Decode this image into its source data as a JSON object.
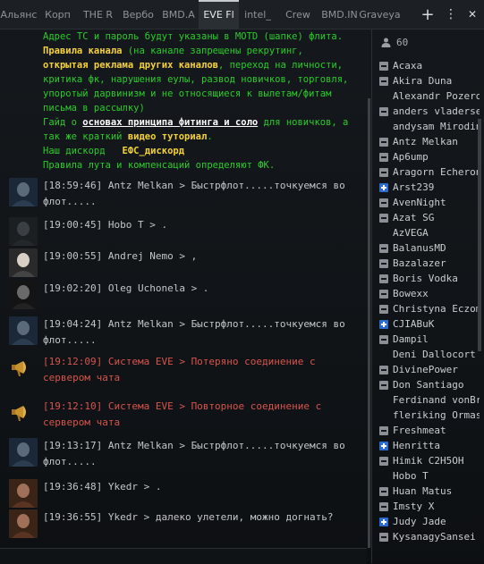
{
  "tabs": [
    {
      "label": "Альянс"
    },
    {
      "label": "Корп"
    },
    {
      "label": "THE R"
    },
    {
      "label": "Вербо"
    },
    {
      "label": "BMD.A"
    },
    {
      "label": "EVE Fl"
    },
    {
      "label": "intel_"
    },
    {
      "label": "Crew"
    },
    {
      "label": "BMD.IN"
    },
    {
      "label": "Graveya"
    }
  ],
  "tab_controls": {
    "add": "+",
    "menu": "⋮",
    "close": "✕"
  },
  "motd": {
    "line1": "Адрес ТС и пароль будут указаны в MOTD (шапке) флита.",
    "rules_label": "Правила канала",
    "rules_text1": " (на канале запрещены рекрутинг, ",
    "ads_label": "открытая реклама других каналов",
    "rules_text2": ", переход на личности, критика фк, нарушения еулы, развод новичков, торговля, упоротый дарвинизм и не относящиеся к вылетам/фитам письма в рассылку)",
    "guide_text1": "Гайд о ",
    "guide_link": "основах принципа фитинга и соло",
    "guide_text2": " для новичков, а так же краткий ",
    "video_label": "видео туториал",
    "guide_text3": ".",
    "discord_text": "Наш дискорд   ",
    "discord_link": "ЕФС_дискорд",
    "loot_text": "Правила лута и компенсаций определяют ФК."
  },
  "messages": [
    {
      "text": "[18:59:46] Antz Melkan > Быстрфлот.....точкуемся во флот.....",
      "type": "user",
      "avatar": "avatar-antz"
    },
    {
      "text": "[19:00:45] Hobo T > .",
      "type": "user",
      "avatar": "avatar-hobo"
    },
    {
      "text": "[19:00:55] Andrej Nemo > ,",
      "type": "user",
      "avatar": "avatar-andrej"
    },
    {
      "text": "[19:02:20] Oleg Uchonela > .",
      "type": "user",
      "avatar": "avatar-oleg"
    },
    {
      "text": "[19:04:24] Antz Melkan > Быстрфлот.....точкуемся во флот.....",
      "type": "user",
      "avatar": "avatar-antz"
    },
    {
      "text": "[19:12:09] Система EVE > Потеряно соединение с сервером чата",
      "type": "system",
      "avatar": "megaphone-icon"
    },
    {
      "text": "[19:12:10] Система EVE > Повторное соединение с сервером чата",
      "type": "system",
      "avatar": "megaphone-icon"
    },
    {
      "text": "[19:13:17] Antz Melkan > Быстрфлот.....точкуемся во флот.....",
      "type": "user",
      "avatar": "avatar-antz"
    },
    {
      "text": "[19:36:48] Ykedr > .",
      "type": "user",
      "avatar": "avatar-ykedr"
    },
    {
      "text": "[19:36:55] Ykedr > далеко улетели, можно догнать?",
      "type": "user",
      "avatar": "avatar-ykedr"
    }
  ],
  "member_count": "60",
  "members": [
    {
      "name": "Acaxa",
      "standing": "neutral"
    },
    {
      "name": "Akira Duna",
      "standing": "neutral"
    },
    {
      "name": "Alexandr Pozerov",
      "standing": "none"
    },
    {
      "name": "anders vladersen",
      "standing": "neutral"
    },
    {
      "name": "andysam Mirodin",
      "standing": "none"
    },
    {
      "name": "Antz Melkan",
      "standing": "neutral"
    },
    {
      "name": "Ap6ump",
      "standing": "neutral"
    },
    {
      "name": "Aragorn Echeron",
      "standing": "neutral"
    },
    {
      "name": "Arst239",
      "standing": "plus"
    },
    {
      "name": "AvenNight",
      "standing": "neutral"
    },
    {
      "name": "Azat SG",
      "standing": "neutral"
    },
    {
      "name": "AzVEGA",
      "standing": "none"
    },
    {
      "name": "BalanusMD",
      "standing": "neutral"
    },
    {
      "name": "Bazalazer",
      "standing": "neutral"
    },
    {
      "name": "Boris Vodka",
      "standing": "neutral"
    },
    {
      "name": "Bowexx",
      "standing": "neutral"
    },
    {
      "name": "Christyna Eczom",
      "standing": "neutral"
    },
    {
      "name": "CJIABuK",
      "standing": "plus"
    },
    {
      "name": "Dampil",
      "standing": "neutral"
    },
    {
      "name": "Deni Dallocort",
      "standing": "none"
    },
    {
      "name": "DivinePower",
      "standing": "neutral"
    },
    {
      "name": "Don Santiago",
      "standing": "neutral"
    },
    {
      "name": "Ferdinand vonBraun",
      "standing": "none"
    },
    {
      "name": "fleriking Ormaster",
      "standing": "none"
    },
    {
      "name": "Freshmeat",
      "standing": "neutral"
    },
    {
      "name": "Henritta",
      "standing": "plus"
    },
    {
      "name": "Himik C2H5OH",
      "standing": "neutral"
    },
    {
      "name": "Hobo T",
      "standing": "none"
    },
    {
      "name": "Huan Matus",
      "standing": "neutral"
    },
    {
      "name": "Imsty X",
      "standing": "neutral"
    },
    {
      "name": "Judy Jade",
      "standing": "plus"
    },
    {
      "name": "KysanagySansei",
      "standing": "neutral"
    }
  ],
  "colors": {
    "motd_green": "#2bcc2b",
    "highlight_yellow": "#f5d23a",
    "system_red": "#d8544c",
    "standing_blue": "#2c6cd0"
  }
}
